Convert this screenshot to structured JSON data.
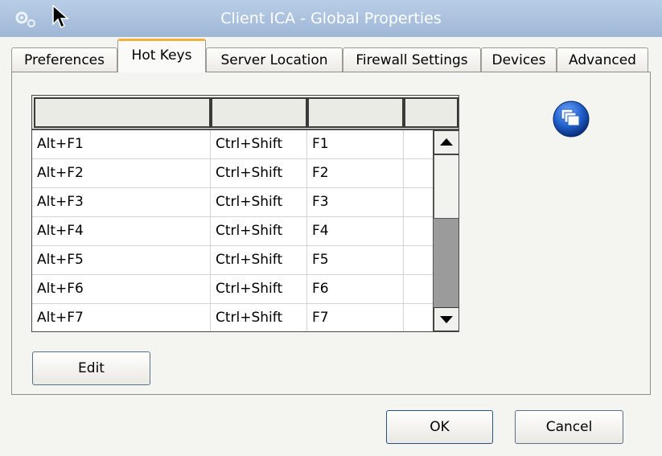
{
  "window": {
    "title": "Client ICA - Global Properties"
  },
  "tabs": [
    {
      "label": "Preferences",
      "active": false
    },
    {
      "label": "Hot Keys",
      "active": true
    },
    {
      "label": "Server Location",
      "active": false
    },
    {
      "label": "Firewall Settings",
      "active": false
    },
    {
      "label": "Devices",
      "active": false
    },
    {
      "label": "Advanced",
      "active": false
    }
  ],
  "hotkeys": {
    "columns": [
      "",
      "",
      "",
      ""
    ],
    "rows": [
      {
        "action": "Alt+F1",
        "modifier": "Ctrl+Shift",
        "key": "F1"
      },
      {
        "action": "Alt+F2",
        "modifier": "Ctrl+Shift",
        "key": "F2"
      },
      {
        "action": "Alt+F3",
        "modifier": "Ctrl+Shift",
        "key": "F3"
      },
      {
        "action": "Alt+F4",
        "modifier": "Ctrl+Shift",
        "key": "F4"
      },
      {
        "action": "Alt+F5",
        "modifier": "Ctrl+Shift",
        "key": "F5"
      },
      {
        "action": "Alt+F6",
        "modifier": "Ctrl+Shift",
        "key": "F6"
      },
      {
        "action": "Alt+F7",
        "modifier": "Ctrl+Shift",
        "key": "F7"
      }
    ]
  },
  "buttons": {
    "edit": "Edit",
    "ok": "OK",
    "cancel": "Cancel"
  },
  "icons": {
    "app": "gears-icon",
    "cursor": "mouse-pointer-icon",
    "side": "windows-stack-icon"
  },
  "colors": {
    "title_bar": "#a9c0dd",
    "active_tab_accent": "#f3b13b",
    "side_icon": "#1f5fc8"
  }
}
